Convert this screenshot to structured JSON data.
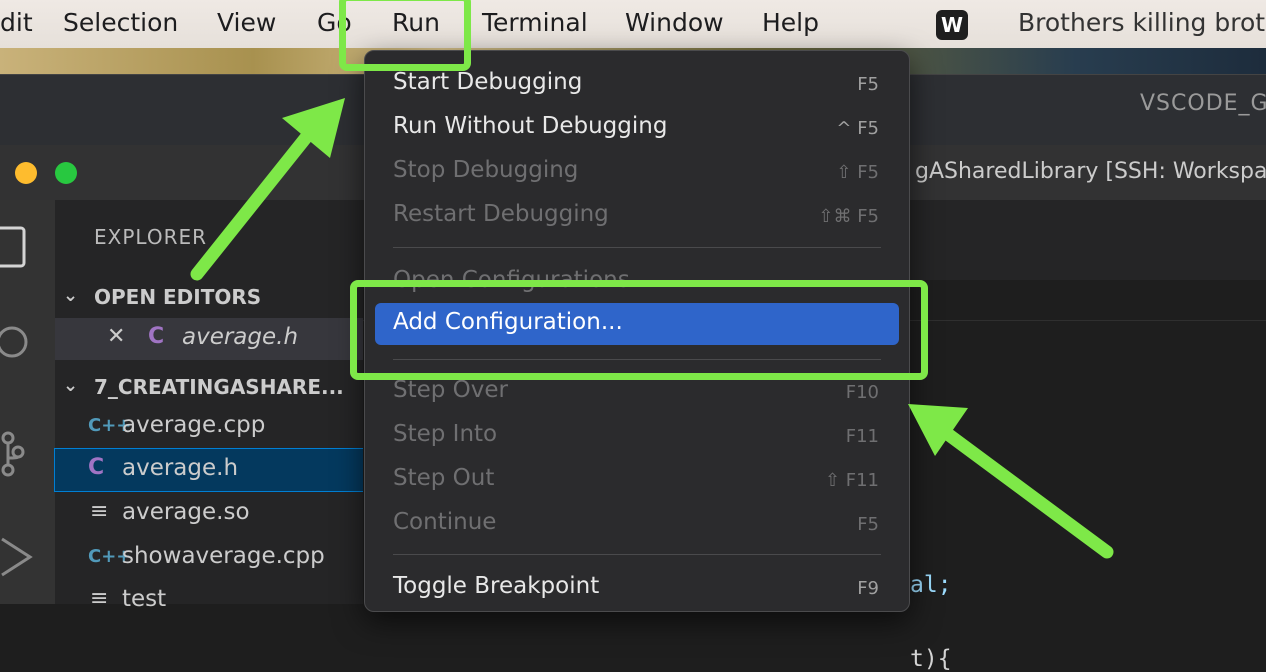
{
  "menubar": {
    "items": [
      "dit",
      "Selection",
      "View",
      "Go",
      "Run",
      "Terminal",
      "Window",
      "Help"
    ],
    "app_icon": "wps-icon",
    "now_playing": "Brothers killing brot"
  },
  "background_window": {
    "title": "VSCODE_G"
  },
  "window": {
    "title": "gASharedLibrary [SSH: Workspa"
  },
  "sidebar": {
    "header": "EXPLORER",
    "open_editors": {
      "label": "OPEN EDITORS",
      "items": [
        {
          "name": "average.h",
          "icon": "C"
        }
      ]
    },
    "folder": {
      "label": "7_CREATINGASHARE...",
      "files": [
        {
          "name": "average.cpp",
          "icon": "C++"
        },
        {
          "name": "average.h",
          "icon": "C"
        },
        {
          "name": "average.so",
          "icon": "text-file-icon"
        },
        {
          "name": "showaverage.cpp",
          "icon": "C++"
        },
        {
          "name": "test",
          "icon": "text-file-icon"
        }
      ]
    }
  },
  "editor": {
    "visible_code": [
      "al;",
      "t){"
    ]
  },
  "run_menu": {
    "items": [
      {
        "label": "Start Debugging",
        "shortcut": "F5",
        "enabled": true
      },
      {
        "label": "Run Without Debugging",
        "shortcut": "^ F5",
        "enabled": true
      },
      {
        "label": "Stop Debugging",
        "shortcut": "⇧ F5",
        "enabled": false
      },
      {
        "label": "Restart Debugging",
        "shortcut": "⇧⌘ F5",
        "enabled": false
      },
      {
        "label": "Open Configurations",
        "shortcut": "",
        "enabled": false
      },
      {
        "label": "Add Configuration...",
        "shortcut": "",
        "enabled": true,
        "selected": true
      },
      {
        "label": "Step Over",
        "shortcut": "F10",
        "enabled": false
      },
      {
        "label": "Step Into",
        "shortcut": "F11",
        "enabled": false
      },
      {
        "label": "Step Out",
        "shortcut": "⇧ F11",
        "enabled": false
      },
      {
        "label": "Continue",
        "shortcut": "F5",
        "enabled": false
      },
      {
        "label": "Toggle Breakpoint",
        "shortcut": "F9",
        "enabled": true
      }
    ]
  },
  "colors": {
    "highlight": "#7ee848",
    "selection": "#2f65ca",
    "menu_bg": "#2b2b2d"
  }
}
